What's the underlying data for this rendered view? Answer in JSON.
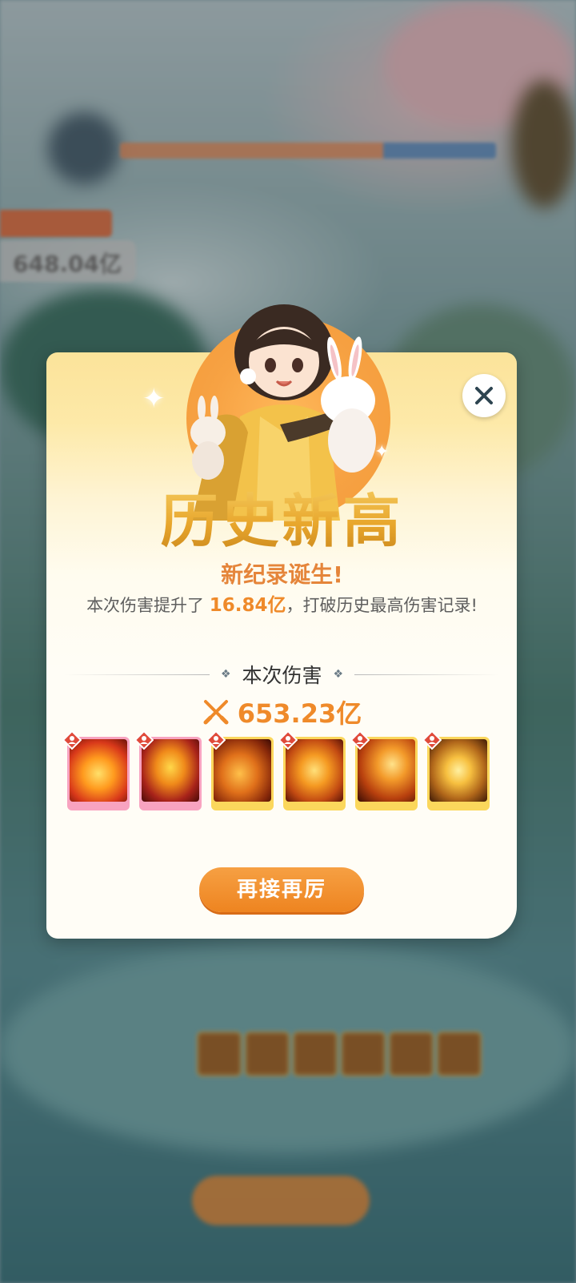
{
  "background": {
    "boss_name": "",
    "damage_value": "648.04亿"
  },
  "dialog": {
    "headline": "历史新高",
    "subtitle": "新纪录诞生!",
    "description_prefix": "本次伤害提升了 ",
    "description_highlight": "16.84亿",
    "description_suffix": "，打破历史最高伤害记录!",
    "section_title": "本次伤害",
    "damage_value": "653.23亿",
    "skills": [
      {
        "name": "lotus-fire",
        "rarity": "pink"
      },
      {
        "name": "phoenix",
        "rarity": "pink"
      },
      {
        "name": "flame-spirit",
        "rarity": "gold"
      },
      {
        "name": "buddha",
        "rarity": "gold"
      },
      {
        "name": "fire-sweep",
        "rarity": "gold"
      },
      {
        "name": "golden-lotus",
        "rarity": "gold"
      }
    ],
    "again_button": "再接再厉"
  },
  "colors": {
    "accent": "#ef8a2a",
    "headline_gold": "#e2a52a",
    "pink_frame": "#f8a3c0",
    "gold_frame": "#fbd75c"
  }
}
